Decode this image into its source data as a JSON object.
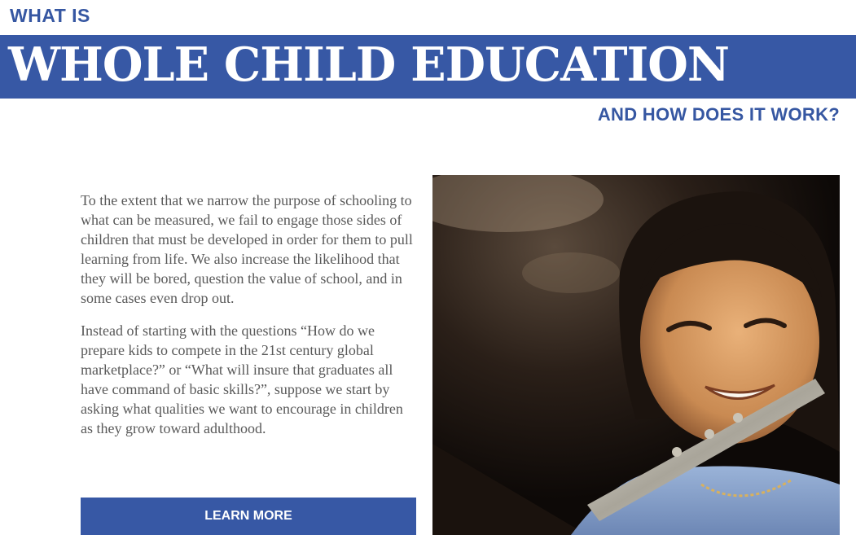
{
  "header": {
    "kicker": "WHAT IS",
    "title": "WHOLE CHILD EDUCATION",
    "subtitle": "AND HOW DOES IT WORK?"
  },
  "content": {
    "paragraphs": [
      "To the extent that we narrow the purpose of schooling to what can be measured, we fail to engage those sides of children that must be developed in order for them to pull learning from life. We also increase the likelihood that they will be bored, question the value of school, and in some cases even drop out.",
      "Instead of starting with the questions “How do we prepare kids to compete in the 21st century global marketplace?” or “What will insure that graduates all have command of basic skills?”, suppose we start by asking what qualities we want to encourage in children as they grow toward adulthood."
    ],
    "cta_label": "LEARN MORE"
  },
  "photo": {
    "subject": "smiling girl playing a flute"
  },
  "colors": {
    "brand_blue": "#3758a5",
    "body_text": "#595959"
  }
}
